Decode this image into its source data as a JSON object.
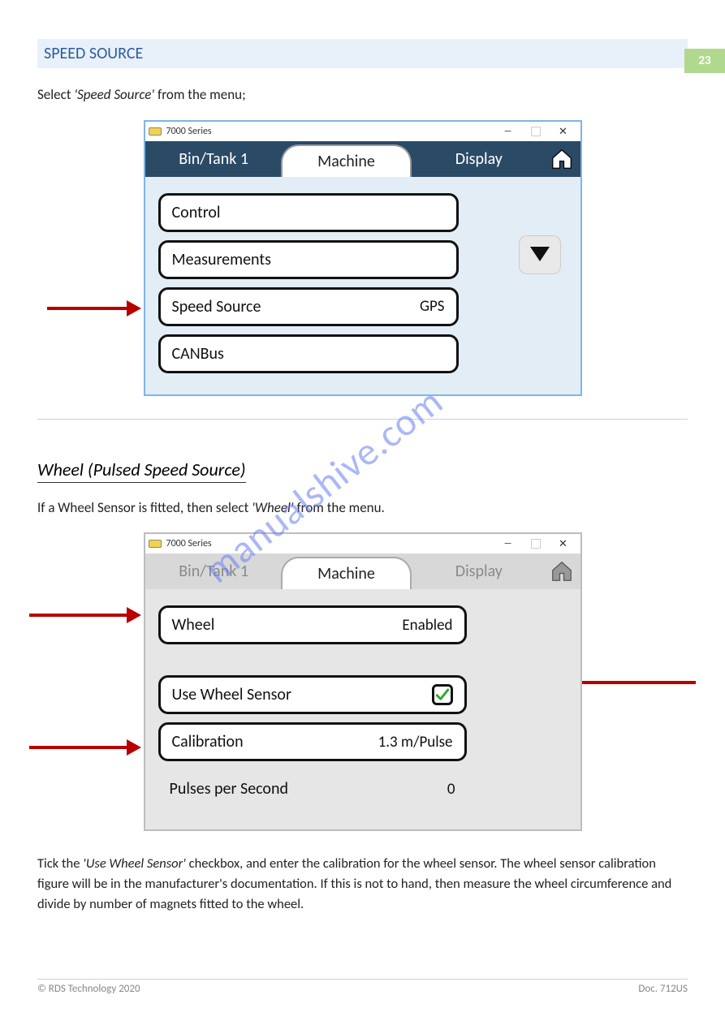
{
  "page_number": "23",
  "banner_heading": "SPEED SOURCE",
  "intro_text_1a": "Select ",
  "intro_text_1b": "'Speed Source'",
  "intro_text_1c": " from the menu;",
  "watermark": "manualshive.com",
  "shot1": {
    "window_title": "7000 Series",
    "tabs": {
      "bin": "Bin/Tank 1",
      "machine": "Machine",
      "display": "Display"
    },
    "rows": {
      "control": "Control",
      "measurements": "Measurements",
      "speed_source_label": "Speed Source",
      "speed_source_value": "GPS",
      "canbus": "CANBus"
    }
  },
  "subheading": "Wheel (Pulsed Speed Source)",
  "sub_para_a": "If a Wheel Sensor is fitted, then select ",
  "sub_para_b": "'Wheel'",
  "sub_para_c": " from the menu.",
  "shot2": {
    "window_title": "7000 Series",
    "tabs": {
      "bin": "Bin/Tank 1",
      "machine": "Machine",
      "display": "Display"
    },
    "rows": {
      "wheel_label": "Wheel",
      "wheel_value": "Enabled",
      "use_wheel_label": "Use Wheel Sensor",
      "calibration_label": "Calibration",
      "calibration_value": "1.3 m/Pulse",
      "pps_label": "Pulses per Second",
      "pps_value": "0"
    }
  },
  "note_a": "Tick the ",
  "note_b": "'Use Wheel Sensor'",
  "note_c": " checkbox, and enter the calibration for the wheel sensor. The wheel sensor calibration figure will be in the manufacturer's documentation. If this is not to hand, then measure the wheel circumference and divide by number of magnets fitted to the wheel.",
  "footer_left": "© RDS Technology 2020",
  "footer_right": "Doc. 712US"
}
